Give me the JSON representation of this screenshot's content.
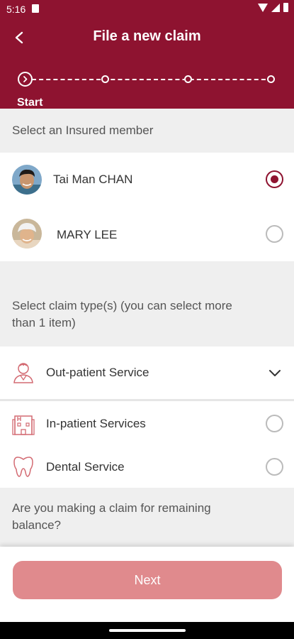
{
  "status_bar": {
    "time": "5:16"
  },
  "header": {
    "title": "File a new claim"
  },
  "stepper": {
    "current_label": "Start",
    "steps_total": 4,
    "current_step": 1
  },
  "insured_section": {
    "title": "Select an Insured member",
    "members": [
      {
        "name": "Tai Man CHAN",
        "selected": true
      },
      {
        "name": "MARY LEE",
        "selected": false
      }
    ]
  },
  "claim_section": {
    "title_line1": "Select claim type(s) (you can select more",
    "title_line2": "than 1 item)",
    "types": [
      {
        "label": "Out-patient Service",
        "icon": "doctor-icon",
        "control": "chevron-down"
      },
      {
        "label": "In-patient Services",
        "icon": "hospital-icon",
        "selected": false
      },
      {
        "label": "Dental Service",
        "icon": "tooth-icon",
        "selected": false
      }
    ]
  },
  "balance_section": {
    "title_line1": "Are you making a claim for remaining",
    "title_line2": "balance?"
  },
  "footer": {
    "next_label": "Next"
  },
  "colors": {
    "brand": "#8e1330",
    "next_button": "#e08a8d",
    "section_bg": "#efefef"
  }
}
